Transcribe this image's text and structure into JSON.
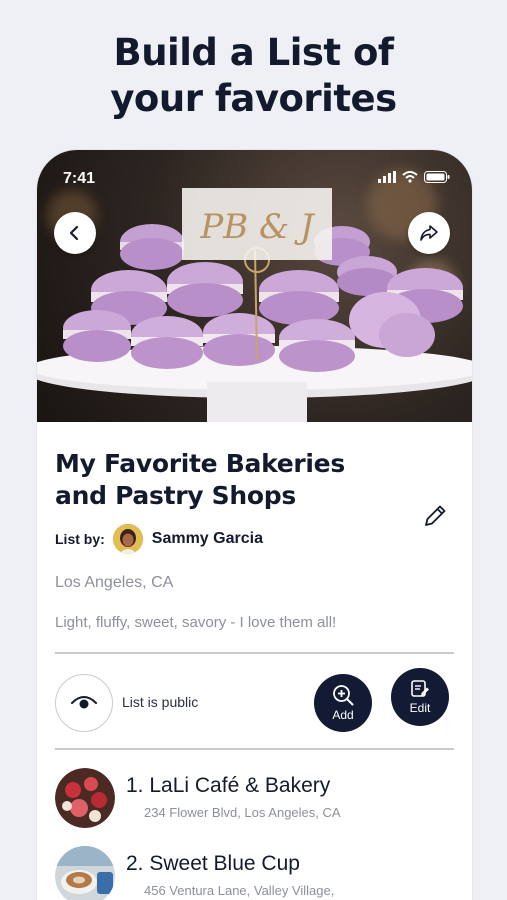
{
  "headline": {
    "line1": "Build a List of",
    "line2": "your favorites"
  },
  "status_bar": {
    "time": "7:41"
  },
  "hero": {
    "sign_text": "PB & J"
  },
  "list": {
    "title": "My Favorite Bakeries and Pastry Shops",
    "by_label": "List by:",
    "author": "Sammy Garcia",
    "location": "Los Angeles, CA",
    "description": "Light, fluffy, sweet, savory - I love them all!",
    "visibility_label": "List is public"
  },
  "actions": {
    "add_label": "Add",
    "edit_label": "Edit"
  },
  "places": [
    {
      "name": "1. LaLi Café & Bakery",
      "address": "234 Flower Blvd, Los Angeles, CA"
    },
    {
      "name": "2. Sweet Blue Cup",
      "address": "456 Ventura Lane, Valley Village,"
    }
  ],
  "colors": {
    "background": "#eef0f5",
    "primary_dark": "#131b34",
    "macaron": "#c9a3d6",
    "muted_text": "#8d909a"
  },
  "icons": [
    "back-arrow-icon",
    "share-icon",
    "pencil-icon",
    "eye-icon",
    "zoom-in-icon",
    "edit-note-icon",
    "signal-icon",
    "wifi-icon",
    "battery-icon"
  ]
}
